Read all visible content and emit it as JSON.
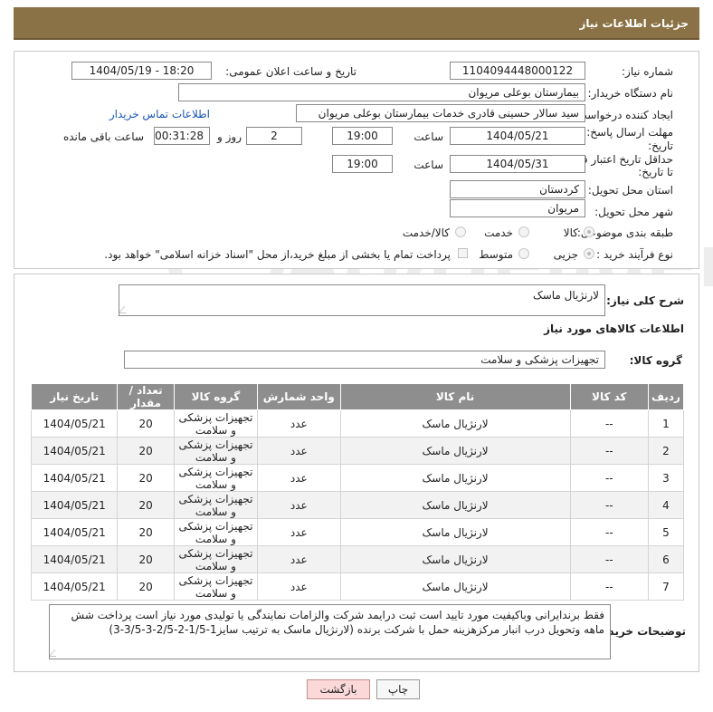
{
  "header": {
    "title": "جزئیات اطلاعات نیاز"
  },
  "form": {
    "need_number_label": "شماره نیاز:",
    "need_number": "1104094448000122",
    "announce_label": "تاریخ و ساعت اعلان عمومی:",
    "announce_value": "1404/05/19 - 18:20",
    "buyer_org_label": "نام دستگاه خریدار:",
    "buyer_org": "بیمارستان بوعلی مریوان",
    "creator_label": "ایجاد کننده درخواست:",
    "creator": "سید سالار حسینی قادری خدمات بیمارستان بوعلی مریوان",
    "contact_link": "اطلاعات تماس خریدار",
    "deadline_label_1": "مهلت ارسال پاسخ: تا",
    "deadline_label_2": "تاریخ:",
    "deadline_date": "1404/05/21",
    "time_label": "ساعت",
    "deadline_time": "19:00",
    "days_value": "2",
    "days_label": "روز و",
    "remaining_time": "00:31:28",
    "remaining_label": "ساعت باقی مانده",
    "validity_label_1": "حداقل تاریخ اعتبار قیمت:",
    "validity_label_2": "تا تاریخ:",
    "validity_date": "1404/05/31",
    "validity_time": "19:00",
    "province_label": "استان محل تحویل:",
    "province": "کردستان",
    "city_label": "شهر محل تحویل:",
    "city": "مریوان",
    "category_label": "طبقه بندی موضوعی:",
    "category_options": [
      "کالا",
      "خدمت",
      "کالا/خدمت"
    ],
    "process_label": "نوع فرآیند خرید :",
    "process_options": [
      "جزیی",
      "متوسط"
    ],
    "payment_note": "پرداخت تمام یا بخشی از مبلغ خرید،از محل \"اسناد خزانه اسلامی\" خواهد بود."
  },
  "description": {
    "label": "شرح کلی نیاز:",
    "value": "لارنژیال ماسک"
  },
  "goods": {
    "section_title": "اطلاعات کالاهای مورد نیاز",
    "group_label": "گروه کالا:",
    "group_value": "تجهیزات پزشکی و سلامت",
    "columns": [
      "ردیف",
      "کد کالا",
      "نام کالا",
      "واحد شمارش",
      "گروه کالا",
      "تعداد / مقدار",
      "تاریخ نیاز"
    ],
    "rows": [
      {
        "row": "1",
        "code": "--",
        "name": "لارنژیال ماسک",
        "unit": "عدد",
        "group": "تجهیزات پزشکی و سلامت",
        "qty": "20",
        "date": "1404/05/21"
      },
      {
        "row": "2",
        "code": "--",
        "name": "لارنژیال ماسک",
        "unit": "عدد",
        "group": "تجهیزات پزشکی و سلامت",
        "qty": "20",
        "date": "1404/05/21"
      },
      {
        "row": "3",
        "code": "--",
        "name": "لارنژیال ماسک",
        "unit": "عدد",
        "group": "تجهیزات پزشکی و سلامت",
        "qty": "20",
        "date": "1404/05/21"
      },
      {
        "row": "4",
        "code": "--",
        "name": "لارنژیال ماسک",
        "unit": "عدد",
        "group": "تجهیزات پزشکی و سلامت",
        "qty": "20",
        "date": "1404/05/21"
      },
      {
        "row": "5",
        "code": "--",
        "name": "لارنژیال ماسک",
        "unit": "عدد",
        "group": "تجهیزات پزشکی و سلامت",
        "qty": "20",
        "date": "1404/05/21"
      },
      {
        "row": "6",
        "code": "--",
        "name": "لارنژیال ماسک",
        "unit": "عدد",
        "group": "تجهیزات پزشکی و سلامت",
        "qty": "20",
        "date": "1404/05/21"
      },
      {
        "row": "7",
        "code": "--",
        "name": "لارنژیال ماسک",
        "unit": "عدد",
        "group": "تجهیزات پزشکی و سلامت",
        "qty": "20",
        "date": "1404/05/21"
      }
    ]
  },
  "buyer_notes": {
    "label": "توضیحات خریدار:",
    "value": "فقط برندایرانی وباکیفیت مورد تایید است ثبت درایمد شرکت والزامات نمایندگی یا تولیدی مورد نیاز است پرداخت شش ماهه وتحویل درب انبار مرکزهزینه حمل با شرکت برنده (لارنژیال ماسک به ترتیب سایز1-1/5-2-2/5-3-3/5-3)"
  },
  "buttons": {
    "print": "چاپ",
    "back": "بازگشت"
  },
  "watermark": {
    "text": "AriaTender.neT"
  }
}
